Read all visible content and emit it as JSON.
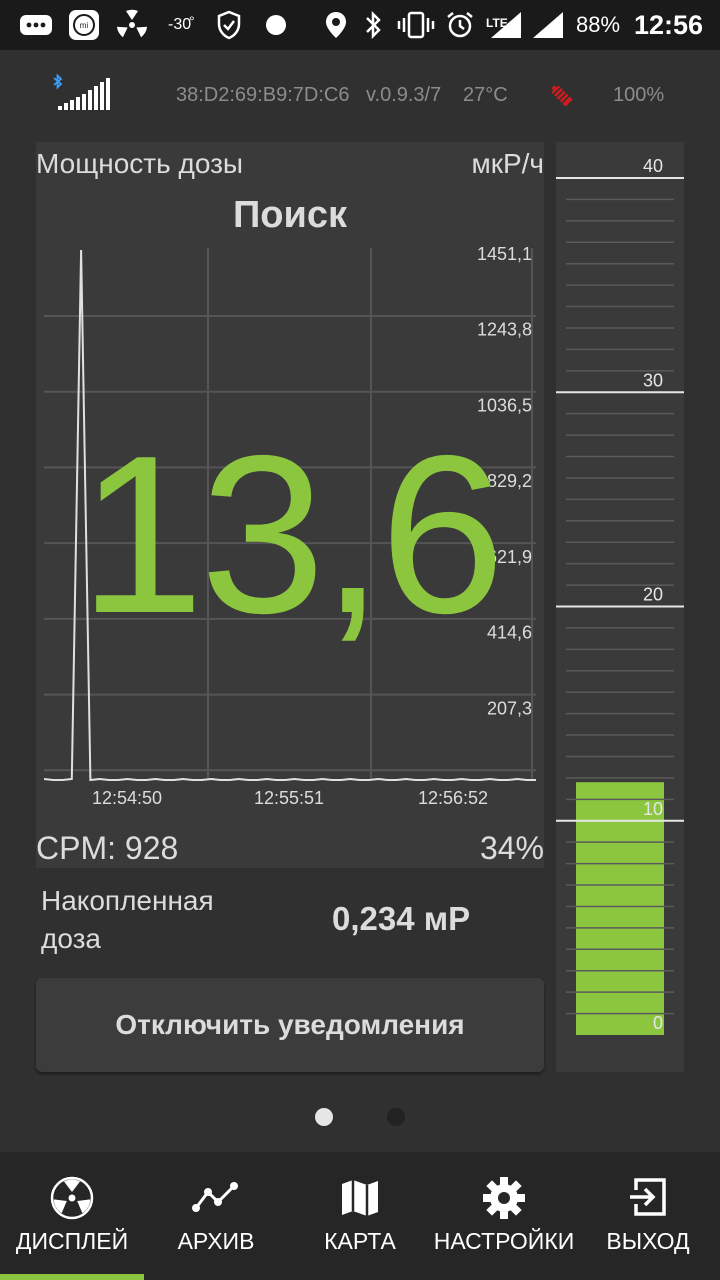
{
  "status_bar": {
    "temp": "-30",
    "lte": "LTE",
    "battery": "88%",
    "time": "12:56"
  },
  "device": {
    "mac": "38:D2:69:B9:7D:C6",
    "version": "v.0.9.3/7",
    "temperature": "27°C",
    "device_battery": "100%"
  },
  "dose_rate": {
    "title": "Мощность дозы",
    "unit": "мкР/ч",
    "mode": "Поиск",
    "value": "13,6",
    "cpm": "CPM: 928",
    "percent": "34%"
  },
  "chart_data": {
    "type": "line",
    "ylim": [
      0,
      1451.1
    ],
    "y_ticks": [
      "1451,1",
      "1243,8",
      "1036,5",
      "829,2",
      "621,9",
      "414,6",
      "207,3"
    ],
    "x_ticks": [
      "12:54:50",
      "12:55:51",
      "12:56:52"
    ],
    "series": [
      {
        "values": [
          0,
          0,
          0,
          0,
          1451,
          0,
          0,
          0,
          0,
          0,
          0,
          0,
          0,
          0,
          0,
          0,
          0,
          0,
          0,
          0,
          0,
          0,
          0,
          0,
          0,
          0,
          0,
          0,
          0,
          0,
          0,
          0,
          0,
          0,
          0,
          0,
          0,
          0,
          0,
          0,
          0,
          0,
          0,
          0,
          0,
          0,
          0,
          0,
          0,
          0,
          0,
          0,
          0,
          0
        ]
      }
    ]
  },
  "gauge": {
    "ticks": [
      "40",
      "30",
      "20",
      "10",
      "0"
    ],
    "value": 11.8,
    "max": 40
  },
  "accumulated": {
    "label": "Накопленная доза",
    "value": "0,234 мР"
  },
  "mute_button": {
    "label": "Отключить уведомления"
  },
  "pager": {
    "pages": 2,
    "active": 0
  },
  "nav": {
    "items": [
      {
        "label": "ДИСПЛЕЙ",
        "icon": "radiation-icon",
        "active": true
      },
      {
        "label": "АРХИВ",
        "icon": "chart-line-icon",
        "active": false
      },
      {
        "label": "КАРТА",
        "icon": "map-icon",
        "active": false
      },
      {
        "label": "НАСТРОЙКИ",
        "icon": "gear-icon",
        "active": false
      },
      {
        "label": "ВЫХОД",
        "icon": "exit-icon",
        "active": false
      }
    ]
  },
  "colors": {
    "accent": "#8cc63f",
    "background": "#303030",
    "panel": "#3a3a3a",
    "navbar": "#262626"
  }
}
